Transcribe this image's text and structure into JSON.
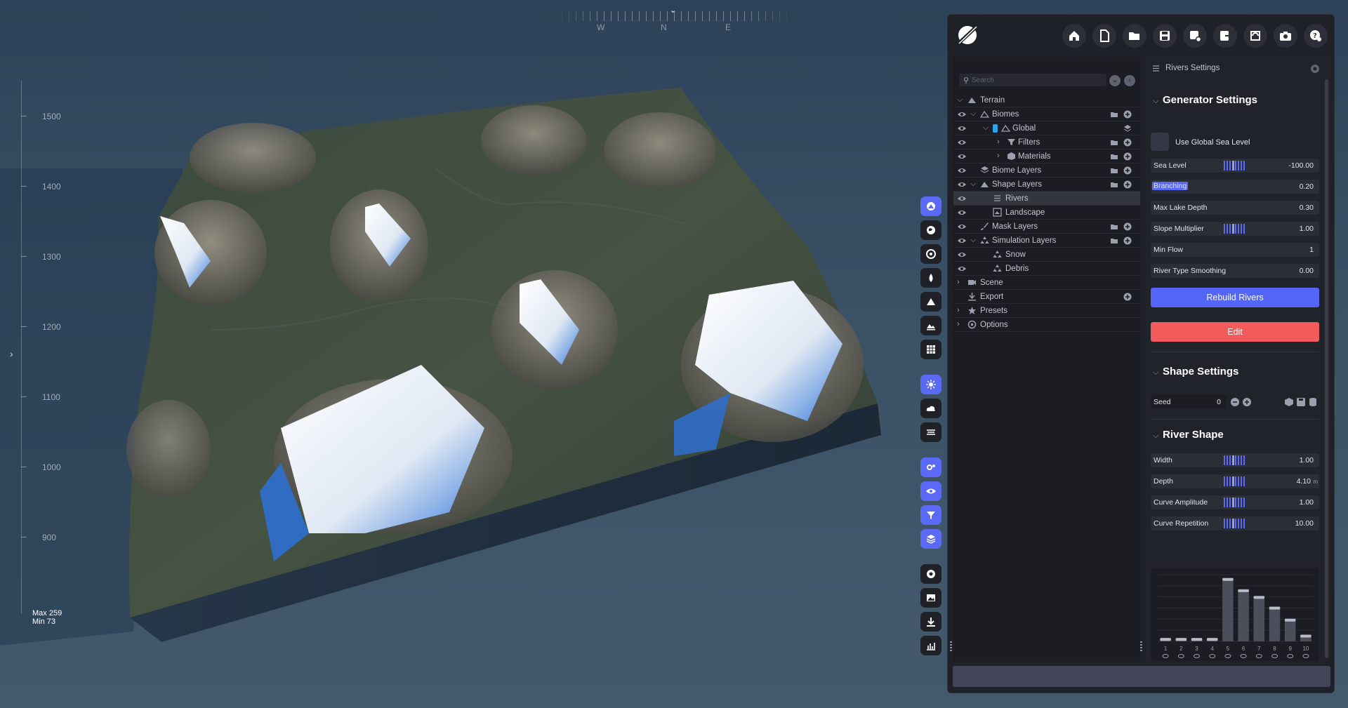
{
  "viewport": {
    "compass": [
      "W",
      "N",
      "E"
    ],
    "scale_labels": [
      "1500",
      "1400",
      "1300",
      "1200",
      "1100",
      "1000",
      "900"
    ],
    "max_label": "Max 259",
    "min_label": "Min 73"
  },
  "toolbar": {
    "buttons": [
      "home-icon",
      "new-file-icon",
      "open-folder-icon",
      "save-icon",
      "save-as-icon",
      "export-icon",
      "refresh-icon",
      "camera-icon",
      "help-icon"
    ]
  },
  "outliner": {
    "search_placeholder": "Search",
    "items": [
      {
        "label": "Terrain"
      },
      {
        "label": "Biomes"
      },
      {
        "label": "Global"
      },
      {
        "label": "Filters"
      },
      {
        "label": "Materials"
      },
      {
        "label": "Biome Layers"
      },
      {
        "label": "Shape Layers"
      },
      {
        "label": "Rivers"
      },
      {
        "label": "Landscape"
      },
      {
        "label": "Mask Layers"
      },
      {
        "label": "Simulation Layers"
      },
      {
        "label": "Snow"
      },
      {
        "label": "Debris"
      },
      {
        "label": "Scene"
      },
      {
        "label": "Export"
      },
      {
        "label": "Presets"
      },
      {
        "label": "Options"
      }
    ]
  },
  "settings": {
    "header": "Rivers Settings",
    "generator": {
      "title": "Generator Settings",
      "use_global_sea_level": "Use Global Sea Level",
      "props": [
        {
          "label": "Sea Level",
          "value": "-100.00"
        },
        {
          "label": "Branching",
          "value": "0.20"
        },
        {
          "label": "Max Lake Depth",
          "value": "0.30"
        },
        {
          "label": "Slope Multiplier",
          "value": "1.00"
        },
        {
          "label": "Min Flow",
          "value": "1"
        },
        {
          "label": "River Type Smoothing",
          "value": "0.00"
        }
      ],
      "rebuild_label": "Rebuild Rivers",
      "edit_label": "Edit"
    },
    "shape": {
      "title": "Shape Settings",
      "seed_label": "Seed",
      "seed_value": "0"
    },
    "river_shape": {
      "title": "River Shape",
      "props": [
        {
          "label": "Width",
          "value": "1.00",
          "unit": ""
        },
        {
          "label": "Depth",
          "value": "4.10",
          "unit": "m"
        },
        {
          "label": "Curve Amplitude",
          "value": "1.00",
          "unit": ""
        },
        {
          "label": "Curve Repetition",
          "value": "10.00",
          "unit": ""
        }
      ]
    }
  },
  "chart_data": {
    "type": "bar",
    "categories": [
      "1",
      "2",
      "3",
      "4",
      "5",
      "6",
      "7",
      "8",
      "9",
      "10"
    ],
    "values": [
      0.05,
      0.05,
      0.05,
      0.05,
      0.95,
      0.78,
      0.68,
      0.52,
      0.34,
      0.1
    ],
    "ylim": [
      0,
      1
    ],
    "grid": true,
    "colors": {
      "bar": "#4b4f5c",
      "cap": "#b9bcc6"
    }
  },
  "colors": {
    "accent": "#5565f8",
    "danger": "#f25b5b",
    "panel": "#1e2127"
  }
}
